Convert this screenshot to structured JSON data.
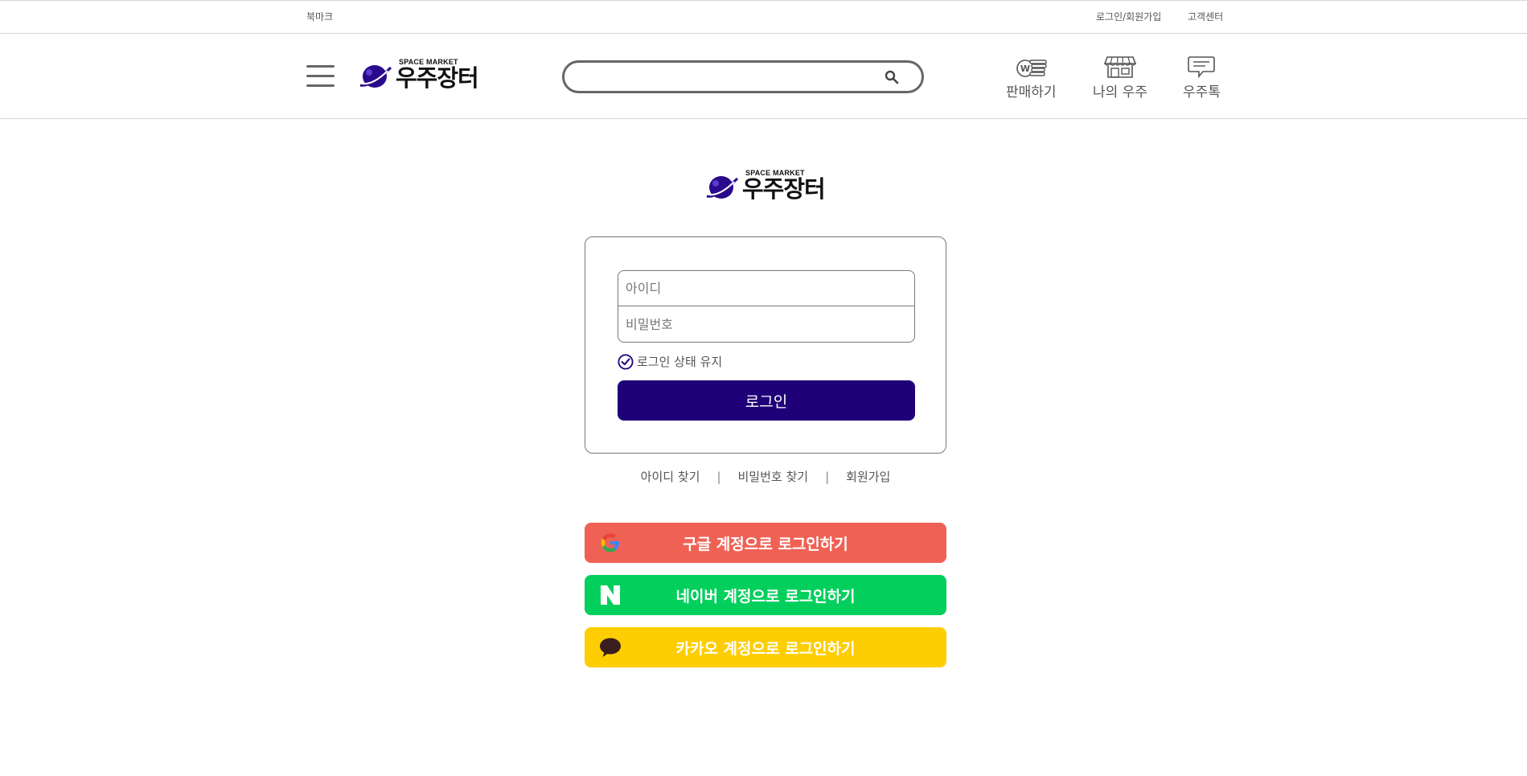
{
  "topbar": {
    "bookmark": "북마크",
    "login_signup": "로그인/회원가입",
    "customer_center": "고객센터"
  },
  "header": {
    "logo": {
      "sub": "SPACE MARKET",
      "main": "우주장터"
    },
    "search": {
      "placeholder": "",
      "value": ""
    },
    "nav": {
      "sell": "판매하기",
      "my_space": "나의 우주",
      "space_talk": "우주톡"
    },
    "icons": [
      "menu-icon",
      "search-icon",
      "won-coin-icon",
      "store-icon",
      "chat-icon"
    ]
  },
  "login": {
    "logo": {
      "sub": "SPACE MARKET",
      "main": "우주장터"
    },
    "id_placeholder": "아이디",
    "password_placeholder": "비밀번호",
    "keep_logged_in": "로그인 상태 유지",
    "login_button": "로그인",
    "links": {
      "find_id": "아이디 찾기",
      "find_password": "비밀번호 찾기",
      "signup": "회원가입",
      "separator": "|"
    }
  },
  "social": {
    "google": "구글 계정으로 로그인하기",
    "naver": "네이버 계정으로 로그인하기",
    "kakao": "카카오 계정으로 로그인하기"
  },
  "colors": {
    "brand": "#1f0078",
    "google": "#f06155",
    "naver": "#03cf5d",
    "kakao": "#fecd02",
    "kakao_icon": "#3a1d1d"
  }
}
